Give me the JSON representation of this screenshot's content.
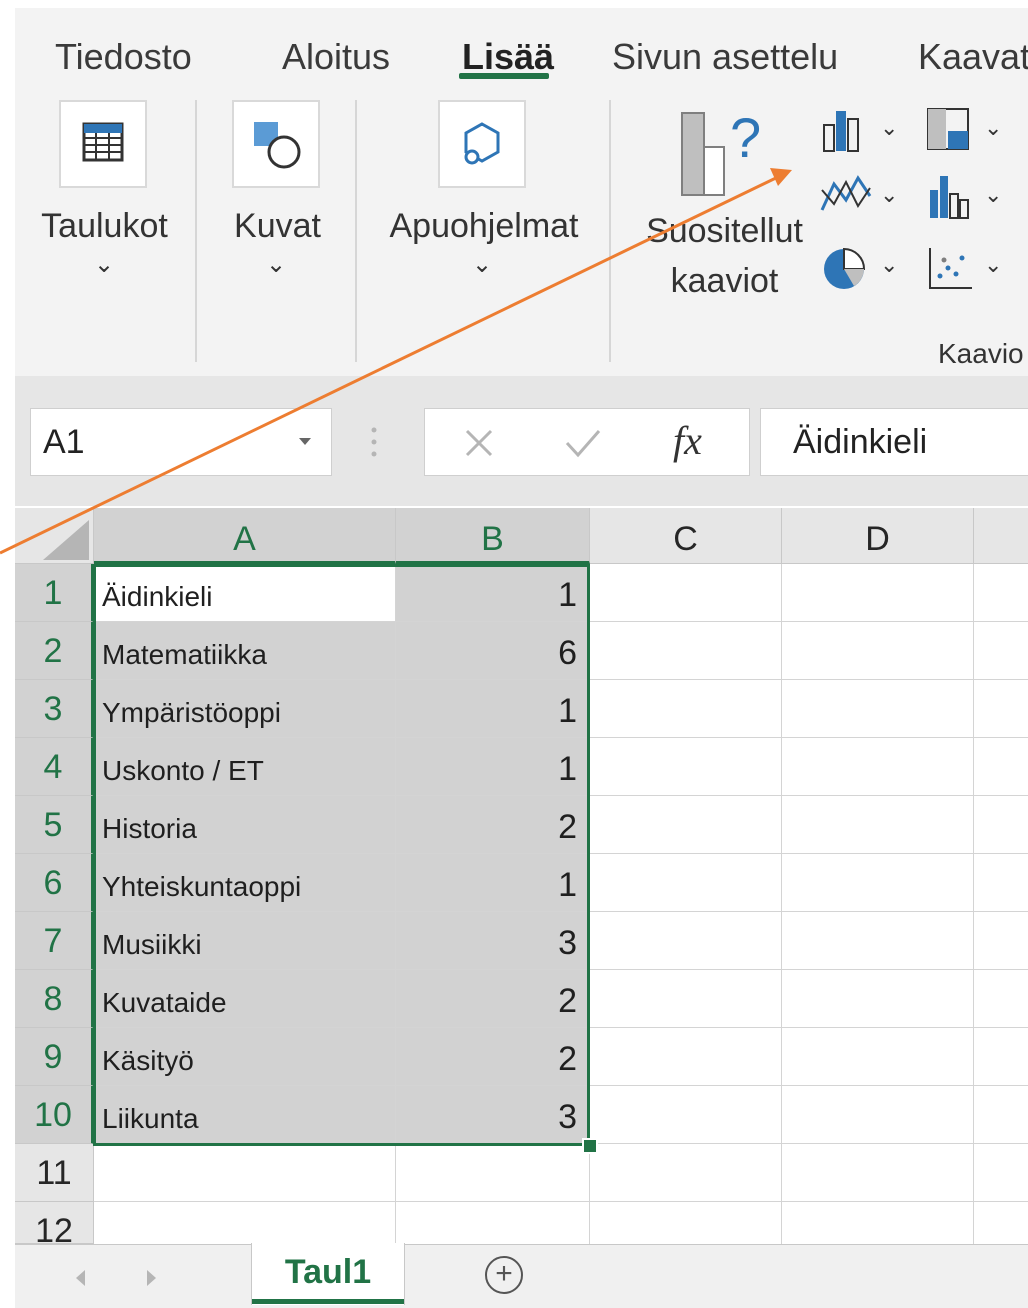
{
  "ribbon": {
    "tabs": [
      {
        "label": "Tiedosto"
      },
      {
        "label": "Aloitus"
      },
      {
        "label": "Lisää"
      },
      {
        "label": "Sivun asettelu"
      },
      {
        "label": "Kaavat"
      }
    ],
    "active_tab": "Lisää",
    "groups": {
      "tables_label": "Taulukot",
      "images_label": "Kuvat",
      "addins_label": "Apuohjelmat",
      "recommended_line1": "Suositellut",
      "recommended_line2": "kaaviot",
      "charts_group_label": "Kaavio"
    },
    "chevron": "⌄"
  },
  "formula_bar": {
    "name_box": "A1",
    "formula_value": "Äidinkieli",
    "fx_label": "fx"
  },
  "sheet": {
    "columns": [
      "A",
      "B",
      "C",
      "D"
    ],
    "rows": [
      {
        "num": "1",
        "subject": "Äidinkieli",
        "value": "1"
      },
      {
        "num": "2",
        "subject": "Matematiikka",
        "value": "6"
      },
      {
        "num": "3",
        "subject": "Ympäristöoppi",
        "value": "1"
      },
      {
        "num": "4",
        "subject": "Uskonto / ET",
        "value": "1"
      },
      {
        "num": "5",
        "subject": "Historia",
        "value": "2"
      },
      {
        "num": "6",
        "subject": "Yhteiskuntaoppi",
        "value": "1"
      },
      {
        "num": "7",
        "subject": "Musiikki",
        "value": "3"
      },
      {
        "num": "8",
        "subject": "Kuvataide",
        "value": "2"
      },
      {
        "num": "9",
        "subject": "Käsityö",
        "value": "2"
      },
      {
        "num": "10",
        "subject": "Liikunta",
        "value": "3"
      }
    ],
    "empty_rows": [
      "11",
      "12"
    ]
  },
  "sheet_tabs": {
    "active": "Taul1",
    "add_label": "+"
  },
  "colors": {
    "accent": "#217346",
    "arrow": "#ed7d31",
    "chart_blue": "#2e75b6"
  }
}
